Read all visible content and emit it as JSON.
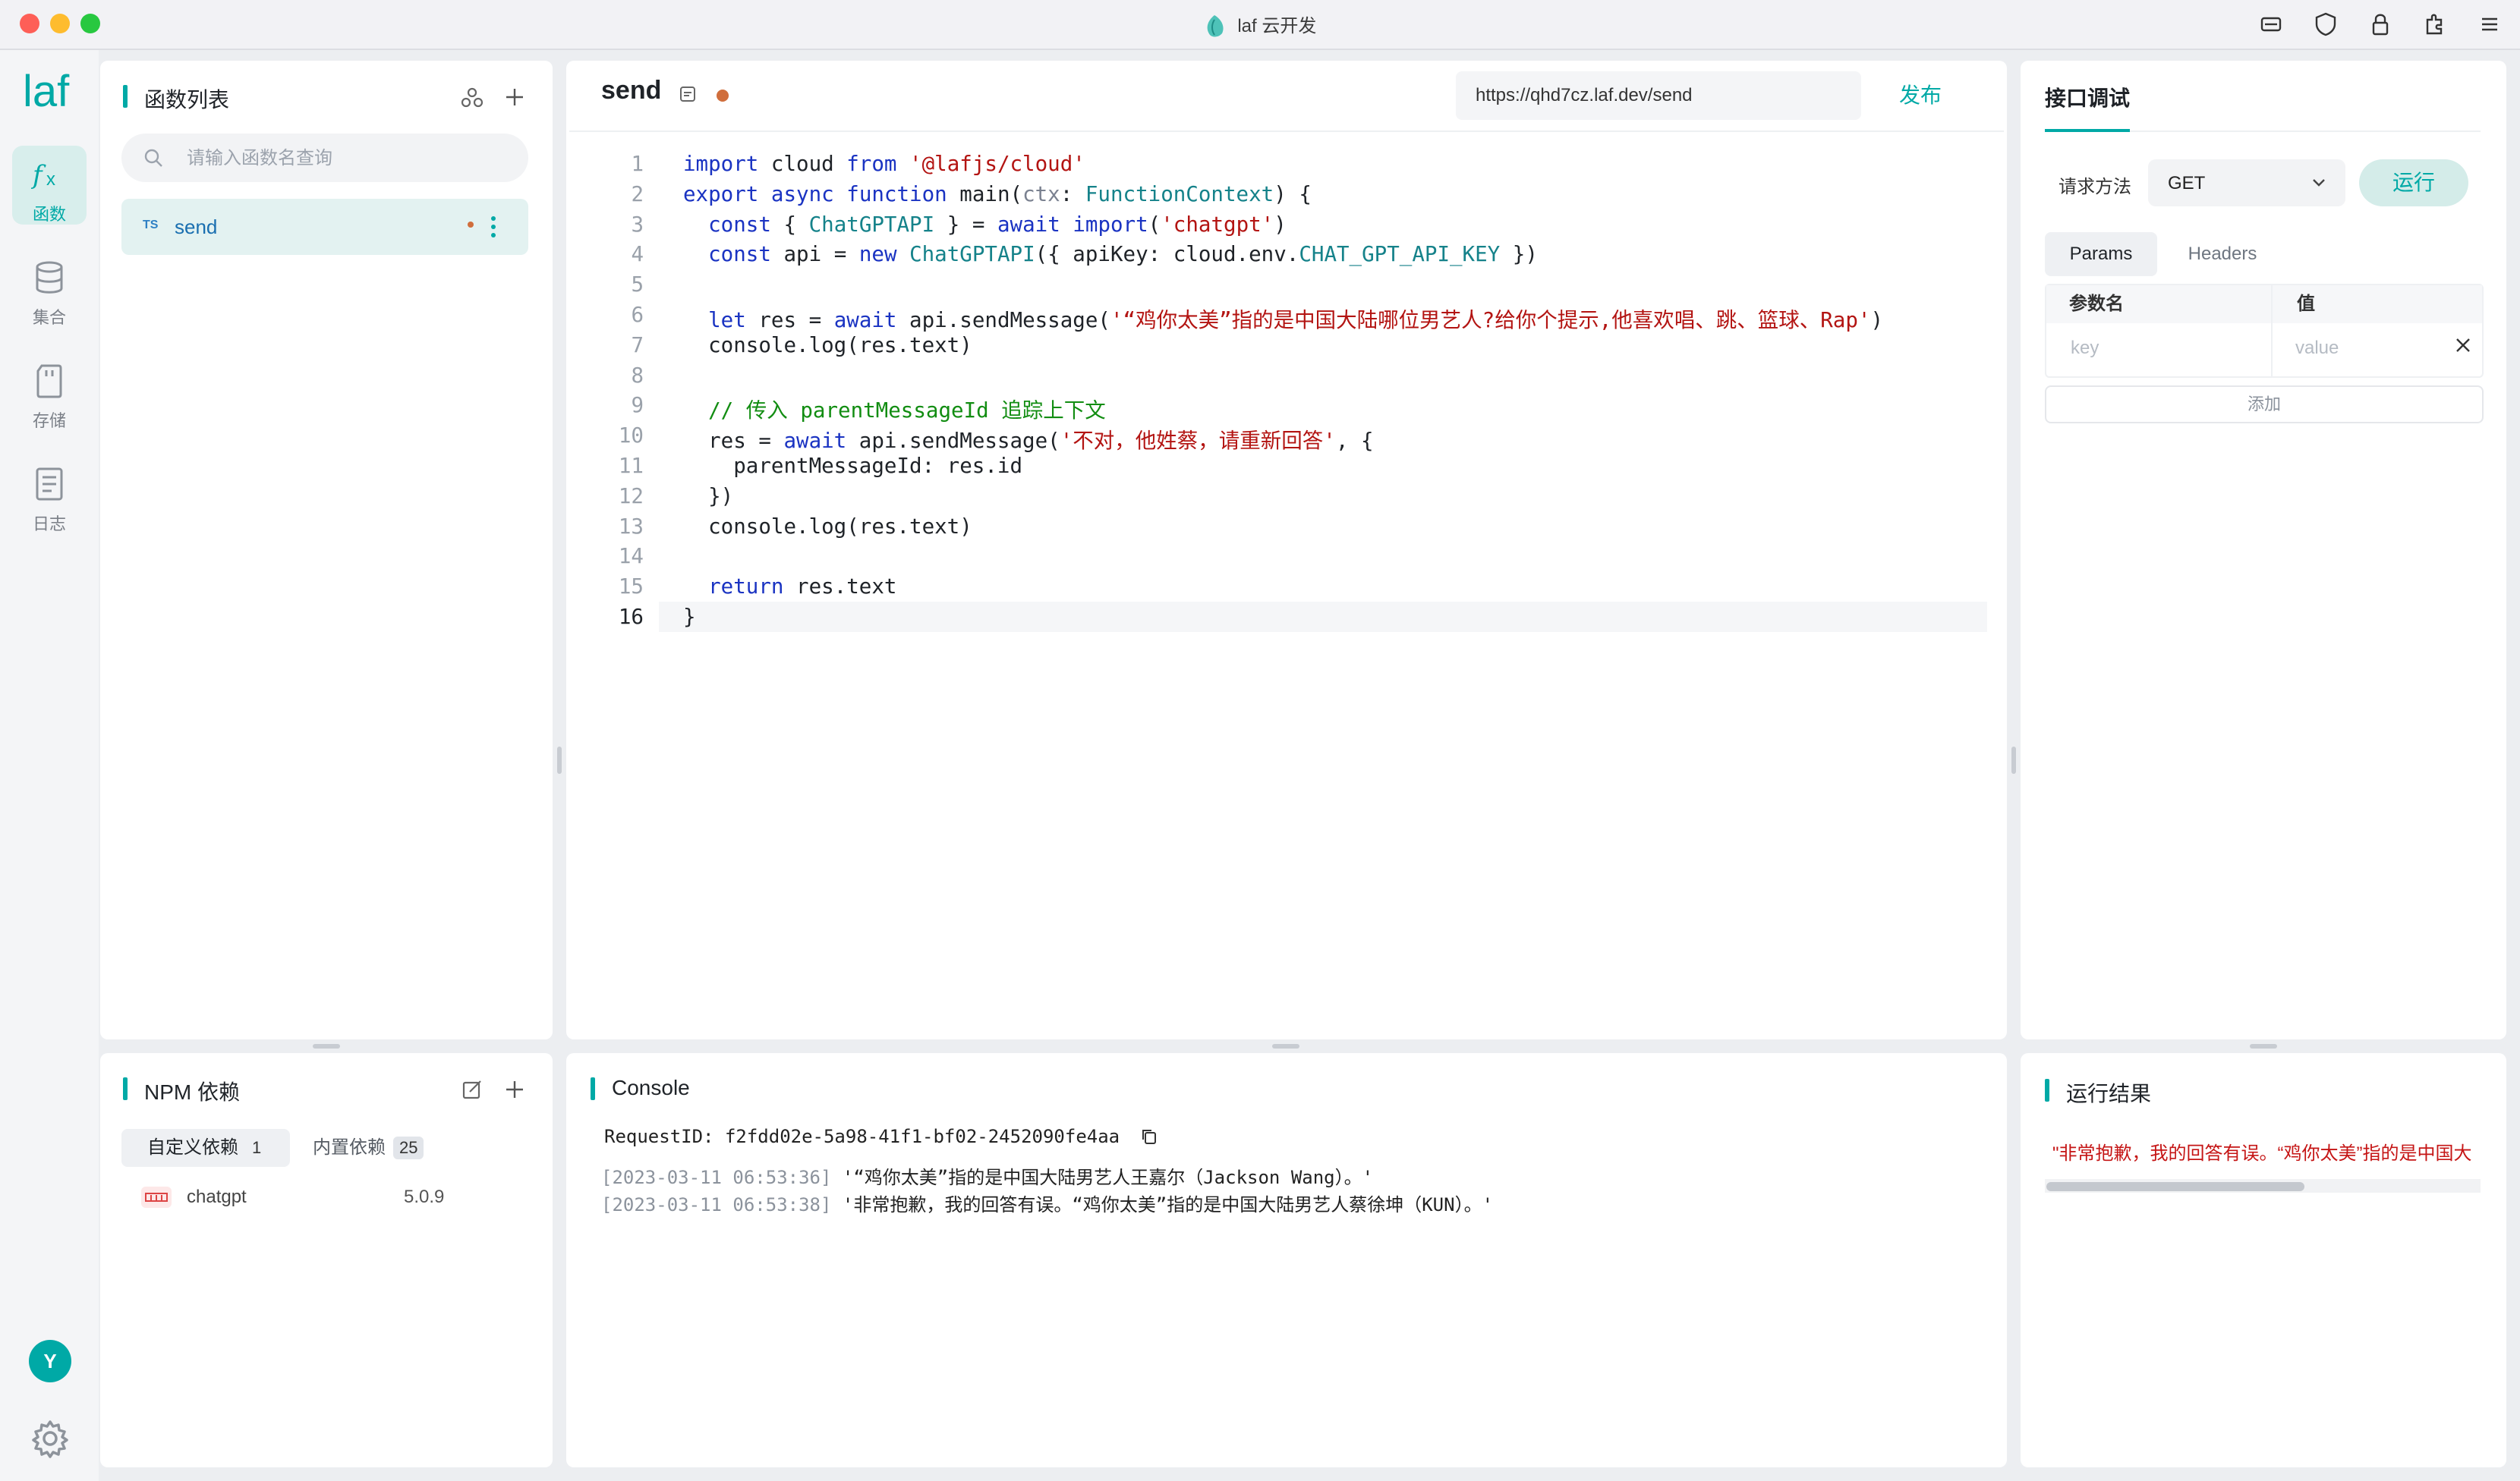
{
  "window": {
    "title": "laf 云开发"
  },
  "nav": {
    "items": [
      {
        "label": "函数"
      },
      {
        "label": "集合"
      },
      {
        "label": "存储"
      },
      {
        "label": "日志"
      }
    ],
    "avatar": "Y"
  },
  "functions": {
    "title": "函数列表",
    "search_placeholder": "请输入函数名查询",
    "items": [
      {
        "lang": "TS",
        "name": "send"
      }
    ]
  },
  "editor": {
    "name": "send",
    "url": "https://qhd7cz.laf.dev/send",
    "publish_label": "发布",
    "lines": [
      {
        "n": "1",
        "code": "import cloud from '@lafjs/cloud'"
      },
      {
        "n": "2",
        "code": "export async function main(ctx: FunctionContext) {"
      },
      {
        "n": "3",
        "code": "  const { ChatGPTAPI } = await import('chatgpt')"
      },
      {
        "n": "4",
        "code": "  const api = new ChatGPTAPI({ apiKey: cloud.env.CHAT_GPT_API_KEY })"
      },
      {
        "n": "5",
        "code": ""
      },
      {
        "n": "6",
        "code": "  let res = await api.sendMessage('“鸡你太美”指的是中国大陆哪位男艺人?给你个提示,他喜欢唱、跳、篮球、Rap')"
      },
      {
        "n": "7",
        "code": "  console.log(res.text)"
      },
      {
        "n": "8",
        "code": ""
      },
      {
        "n": "9",
        "code": "  // 传入 parentMessageId 追踪上下文"
      },
      {
        "n": "10",
        "code": "  res = await api.sendMessage('不对，他姓蔡，请重新回答', {"
      },
      {
        "n": "11",
        "code": "    parentMessageId: res.id"
      },
      {
        "n": "12",
        "code": "  })"
      },
      {
        "n": "13",
        "code": "  console.log(res.text)"
      },
      {
        "n": "14",
        "code": ""
      },
      {
        "n": "15",
        "code": "  return res.text"
      },
      {
        "n": "16",
        "code": "}"
      }
    ]
  },
  "debug": {
    "tab_label": "接口调试",
    "method_label": "请求方法",
    "method": "GET",
    "run_label": "运行",
    "tabs": [
      "Params",
      "Headers"
    ],
    "param_header_name": "参数名",
    "param_header_value": "值",
    "key_placeholder": "key",
    "value_placeholder": "value",
    "add_label": "添加"
  },
  "deps": {
    "title": "NPM 依赖",
    "custom_label": "自定义依赖",
    "custom_count": "1",
    "builtin_label": "内置依赖",
    "builtin_count": "25",
    "items": [
      {
        "name": "chatgpt",
        "version": "5.0.9"
      }
    ]
  },
  "console": {
    "title": "Console",
    "request_id": "RequestID: f2fdd02e-5a98-41f1-bf02-2452090fe4aa",
    "logs": [
      {
        "time": "[2023-03-11 06:53:36]",
        "text": "'“鸡你太美”指的是中国大陆男艺人王嘉尔（Jackson Wang）。'"
      },
      {
        "time": "[2023-03-11 06:53:38]",
        "text": "'非常抱歉，我的回答有误。“鸡你太美”指的是中国大陆男艺人蔡徐坤（KUN）。'"
      }
    ]
  },
  "result": {
    "title": "运行结果",
    "text": "\"非常抱歉，我的回答有误。“鸡你太美”指的是中国大"
  },
  "colors": {
    "accent": "#00a9a6",
    "string": "#b31412",
    "keyword": "#1a33c2",
    "comment": "#128d12"
  }
}
